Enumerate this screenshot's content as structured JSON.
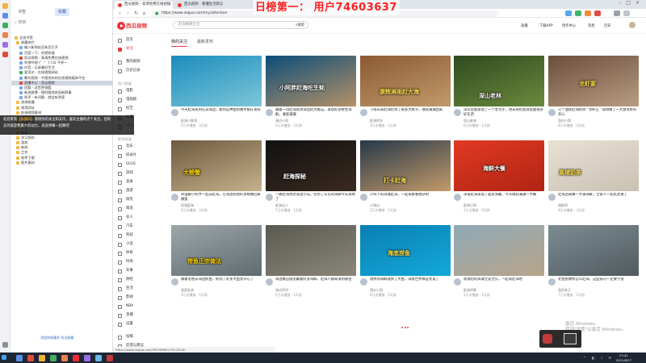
{
  "banner": {
    "text": "日榜第一：    用户74603637"
  },
  "browser": {
    "tabs": [
      {
        "label": "西瓜视频 - 高清免费在线视频"
      },
      {
        "label": "西瓜视频 - 看懂生活新瓜"
      }
    ],
    "url": "https://www.ixigua.com/my/attention",
    "status_bar": "https://www.ixigua.com/?6976980179123040"
  },
  "bookmarks_panel": {
    "tabs": [
      "书签",
      "收藏"
    ],
    "search_placeholder": "搜索",
    "items": [
      {
        "label": "全部书签",
        "depth": 0,
        "icon": "folder"
      },
      {
        "label": "收藏夹栏",
        "depth": 1,
        "icon": "folder"
      },
      {
        "label": "输入新网址回车后打开",
        "depth": 2,
        "icon": "page"
      },
      {
        "label": "百度一下，你就知道",
        "depth": 2,
        "icon": "page"
      },
      {
        "label": "西瓜视频 - 高清免费在线视频",
        "depth": 2,
        "icon": "red"
      },
      {
        "label": "哔哩哔哩 (゜-゜)つロ 干杯~",
        "depth": 2,
        "icon": "page"
      },
      {
        "label": "抖音 - 记录美好生活",
        "depth": 2,
        "icon": "page"
      },
      {
        "label": "爱奇艺 - 在线视频网站",
        "depth": 2,
        "icon": "green"
      },
      {
        "label": "腾讯视频 - 中国领先的在线视频媒体平台",
        "depth": 2,
        "icon": "page"
      },
      {
        "label": "直播中心 - 西瓜视频",
        "depth": 2,
        "icon": "red",
        "selected": true
      },
      {
        "label": "优酷 - 这世界很酷",
        "depth": 2,
        "icon": "page"
      },
      {
        "label": "新浪微博 - 随时随地发现新鲜事",
        "depth": 2,
        "icon": "page"
      },
      {
        "label": "知乎 - 有问题，就会有答案",
        "depth": 2,
        "icon": "page"
      },
      {
        "label": "其他收藏",
        "depth": 1,
        "icon": "folder"
      },
      {
        "label": "常用网址",
        "depth": 1,
        "icon": "folder"
      },
      {
        "label": "赶海视频素材",
        "depth": 1,
        "icon": "folder"
      },
      {
        "label": "视频剪辑",
        "depth": 1,
        "icon": "folder"
      },
      {
        "label": "直播工具",
        "depth": 1,
        "icon": "folder"
      },
      {
        "label": "音乐",
        "depth": 1,
        "icon": "folder"
      },
      {
        "label": "购物",
        "depth": 1,
        "icon": "folder"
      },
      {
        "label": "学习资料",
        "depth": 1,
        "icon": "folder"
      },
      {
        "label": "游戏",
        "depth": 1,
        "icon": "folder"
      },
      {
        "label": "新闻",
        "depth": 1,
        "icon": "folder"
      },
      {
        "label": "工作",
        "depth": 1,
        "icon": "folder"
      },
      {
        "label": "软件下载",
        "depth": 1,
        "icon": "folder"
      },
      {
        "label": "图片素材",
        "depth": 1,
        "icon": "folder"
      }
    ],
    "footer": "添加到收藏夹  导出收藏"
  },
  "overlay": {
    "line1_prefix": "欢迎来到",
    "line1_highlight": "【直播间】",
    "line1_rest": "谢谢你的关注和支持，喜欢主播的点个关注，您的",
    "line2": "支持就是我最大的动力，发送弹幕一起聊吧"
  },
  "site": {
    "logo": "西瓜视频",
    "search_placeholder": "赶海视频大全",
    "search_button": "搜索",
    "header_links": [
      "直播",
      "下载APP",
      "创作中心",
      "消息",
      "历史"
    ],
    "nav_sections": [
      {
        "heading": "",
        "items": [
          "首页",
          "关注"
        ]
      },
      {
        "heading": "",
        "items": [
          "我的视频",
          "历史记录"
        ]
      },
      {
        "heading": "热门频道",
        "items": [
          "电影",
          "电视剧",
          "综艺",
          "动漫",
          "少儿"
        ]
      },
      {
        "heading": "更多频道",
        "items": [
          "音乐",
          "纪录片",
          "VLOG",
          "游戏",
          "美食",
          "旅游",
          "搞笑",
          "萌宠",
          "农人",
          "汽车",
          "科技",
          "小说",
          "体育",
          "时尚",
          "军事",
          "财经",
          "生活",
          "影视",
          "NBA",
          "直播",
          "设置"
        ]
      },
      {
        "heading": "",
        "items": [
          "投稿",
          "反馈与建议"
        ]
      }
    ],
    "active_nav": "关注",
    "content_tabs": [
      "我的关注",
      "最新发布"
    ]
  },
  "videos": [
    {
      "title": "今天赶海来到在去海边，看到这种鱼狗蟹手都在发抖",
      "author": "赶海小胖哥",
      "stats": "2万次播放 · 3天前",
      "caption": "",
      "colors": [
        "#1b8dbd",
        "#7dc6d9"
      ]
    },
    {
      "title": "跟着一哥赶海来到海边的大礁石，发现好多野生海鲜，收获满满",
      "author": "海边小哥",
      "stats": "5万次播放 · 2天前",
      "caption": "小阿胖赶海吃生蚝",
      "colors": [
        "#0c4d7a",
        "#b59166"
      ]
    },
    {
      "title": "下雨天来赶海挖到了很多大蛏子，收获满满回家",
      "author": "赶海阿东",
      "stats": "3万次播放 · 1天前",
      "caption": "康辉淋雨赶大海",
      "colors": [
        "#8c5a34",
        "#c19a6b"
      ]
    },
    {
      "title": "深山里面发现了一个老宅子，进去探险发现里面很多好东西",
      "author": "深山老林",
      "stats": "6万次播放 · 1天前",
      "caption": "深山老林",
      "colors": [
        "#2f4a1f",
        "#6b8a3d"
      ]
    },
    {
      "title": "三个渔民赶海抓到 “龙虾王” 现场做了一大盘龙虾好开心",
      "author": "渔村小哥",
      "stats": "8万次播放 · 3天前",
      "caption": "龙虾宴",
      "colors": [
        "#6c4e3c",
        "#b89c82"
      ]
    },
    {
      "title": "阿强跟小伙伴一起去赶海，在海边抓到好多螃蟹回家做饭",
      "author": "阿强赶海",
      "stats": "4万次播放 · 2天前",
      "caption": "大螃蟹",
      "colors": [
        "#6e5a3f",
        "#c6b18d"
      ]
    },
    {
      "title": "一路赶海到达海边小岛，挖到了罕见的海鲜今天发财了",
      "author": "赶海达人",
      "stats": "7万次播放 · 1天前",
      "caption": "赶海探秘",
      "colors": [
        "#111111",
        "#3a2a20"
      ]
    },
    {
      "title": "夕阳下的海滩赶海，一起来看看收获吧",
      "author": "小海边",
      "stats": "2万次播放 · 1天前",
      "caption": "打卡赶海",
      "colors": [
        "#263849",
        "#c39a6a"
      ]
    },
    {
      "title": "深夜赶海发现了超多海螺，今天收获满满一大桶",
      "author": "赶海小哥",
      "stats": "3万次播放 · 5天前",
      "caption": "海鲜大餐",
      "colors": [
        "#e03a22",
        "#b02414"
      ]
    },
    {
      "title": "赶海回来做一大锅海鲜，全家人一起吃太香了",
      "author": "海鲜哥",
      "stats": "9万次播放 · 3天前",
      "caption": "真猪奶茶",
      "colors": [
        "#e8e1d4",
        "#c9c1b2"
      ]
    },
    {
      "title": "跟着老爸去海边抓鱼，抓到了好多大鱼太开心了",
      "author": "渔家女孩",
      "stats": "4万次播放 · 1天前",
      "caption": "带鱼正宗做法",
      "colors": [
        "#9ea6a9",
        "#5f6b70"
      ]
    },
    {
      "title": "海边礁石缝里藏着好多海鲜，赶海人都知道的秘密",
      "author": "海边阿华",
      "stats": "5万次播放 · 2天前",
      "caption": "",
      "colors": [
        "#5a5a52",
        "#8a867a"
      ]
    },
    {
      "title": "潜水抓海鲜遇到了大鱼，海底世界真是太美了",
      "author": "潜水小哥",
      "stats": "6万次播放 · 1天前",
      "caption": "海底捞鱼",
      "colors": [
        "#0a7fb4",
        "#13a9d8"
      ]
    },
    {
      "title": "退潮后的海滩全是宝贝，一起来赶海吧",
      "author": "赶海阿辉",
      "stats": "3万次播放 · 2天前",
      "caption": "",
      "colors": [
        "#8fa9b7",
        "#b7a489"
      ]
    },
    {
      "title": "老渔民教你怎么赶海，这些技巧一定要学会",
      "author": "渔民老王",
      "stats": "7万次播放 · 1天前",
      "caption": "",
      "colors": [
        "#7e8d93",
        "#4f5a5e"
      ]
    }
  ],
  "windows": {
    "watermark_line1": "激活 Windows",
    "watermark_line2": "转到\"设置\"以激活 Windows。",
    "clock_time": "23:41",
    "clock_date": "2021/6/27"
  }
}
